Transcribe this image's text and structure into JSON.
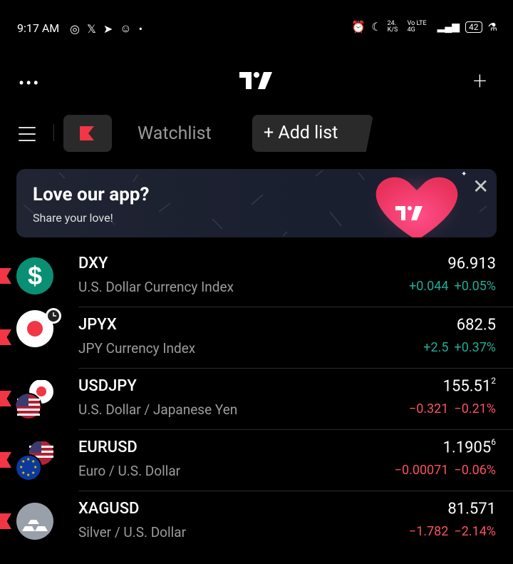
{
  "status_bar": {
    "time": "9:17 AM",
    "right_text": "24. K/S",
    "network": "Vo LTE 4G",
    "battery": "42"
  },
  "header": {},
  "toolbar": {
    "tab_watchlist": "Watchlist",
    "add_list_label": "+ Add list"
  },
  "banner": {
    "title": "Love our app?",
    "subtitle": "Share your love!"
  },
  "watchlist": [
    {
      "symbol": "DXY",
      "description": "U.S. Dollar Currency Index",
      "price": "96.913",
      "price_sup": "",
      "change": "+0.044",
      "change_pct": "+0.05%",
      "direction": "up",
      "icon": "dollar-icon"
    },
    {
      "symbol": "JPYX",
      "description": "JPY Currency Index",
      "price": "682.5",
      "price_sup": "",
      "change": "+2.5",
      "change_pct": "+0.37%",
      "direction": "up",
      "icon": "japan-flag-icon"
    },
    {
      "symbol": "USDJPY",
      "description": "U.S. Dollar / Japanese Yen",
      "price": "155.51",
      "price_sup": "2",
      "change": "−0.321",
      "change_pct": "−0.21%",
      "direction": "down",
      "icon": "usd-jpy-flags-icon"
    },
    {
      "symbol": "EURUSD",
      "description": "Euro / U.S. Dollar",
      "price": "1.1905",
      "price_sup": "6",
      "change": "−0.00071",
      "change_pct": "−0.06%",
      "direction": "down",
      "icon": "eur-usd-flags-icon"
    },
    {
      "symbol": "XAGUSD",
      "description": "Silver / U.S. Dollar",
      "price": "81.571",
      "price_sup": "",
      "change": "−1.782",
      "change_pct": "−2.14%",
      "direction": "down",
      "icon": "silver-bars-icon"
    }
  ],
  "colors": {
    "accent_red": "#f23645",
    "positive": "#22ab94",
    "negative": "#f7525f"
  }
}
